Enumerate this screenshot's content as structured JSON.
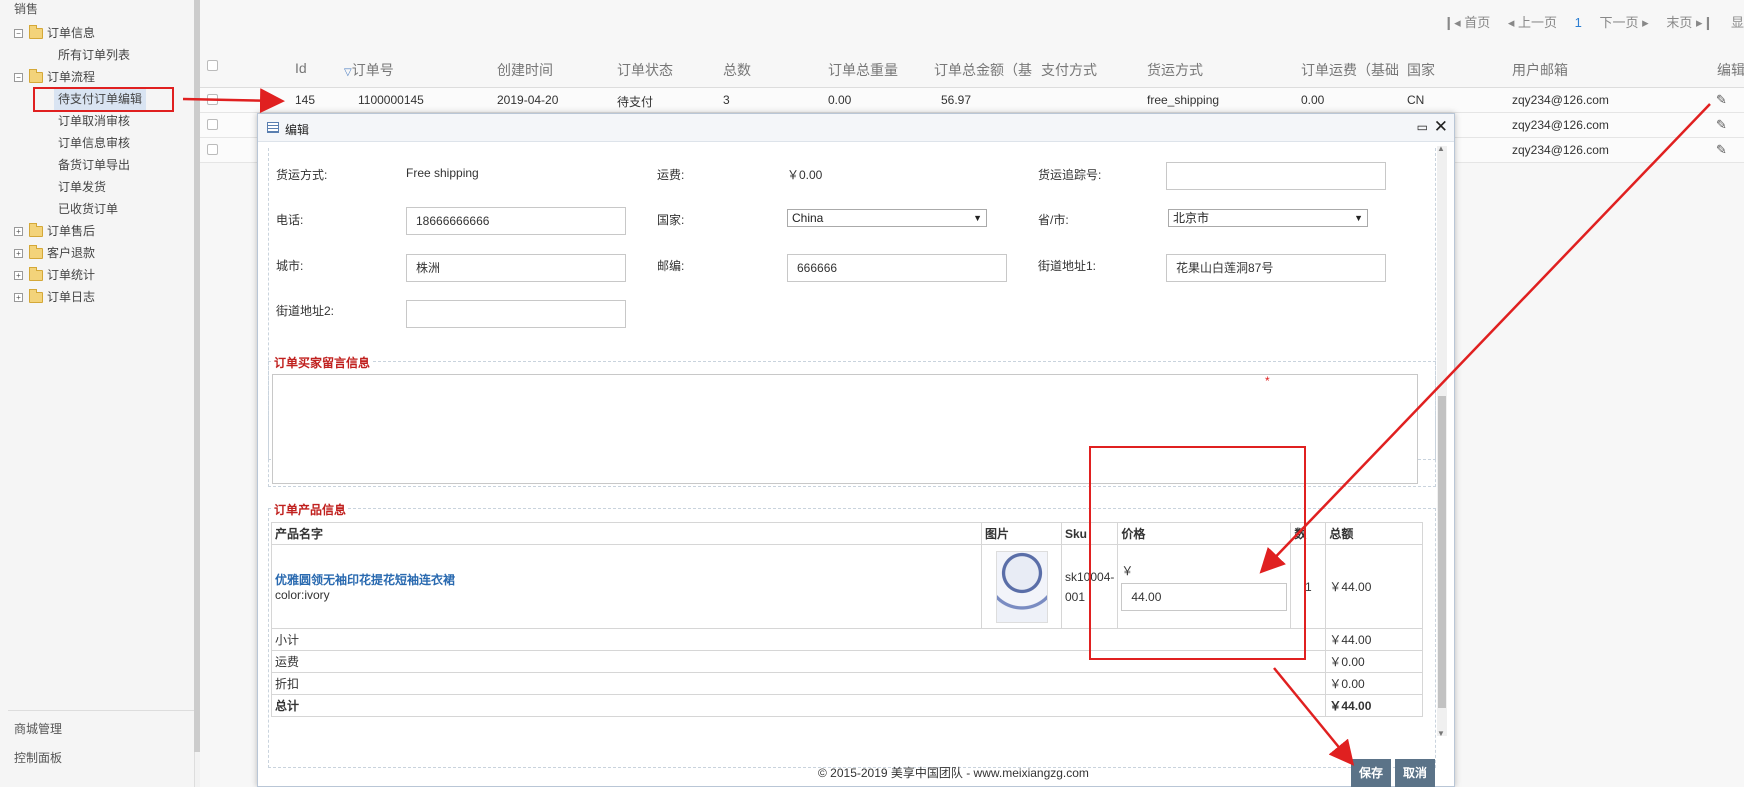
{
  "sidebar": {
    "section_title": "销售",
    "tree": [
      {
        "label": "订单信息",
        "toggle": "−"
      },
      {
        "label": "订单流程",
        "toggle": "−"
      },
      {
        "label": "订单售后",
        "toggle": "+"
      },
      {
        "label": "客户退款",
        "toggle": "+"
      },
      {
        "label": "订单统计",
        "toggle": "+"
      },
      {
        "label": "订单日志",
        "toggle": "+"
      }
    ],
    "leaves": [
      "所有订单列表",
      "待支付订单编辑",
      "订单取消审核",
      "订单信息审核",
      "备货订单导出",
      "订单发货",
      "已收货订单"
    ],
    "bottom": [
      "商城管理",
      "控制面板"
    ]
  },
  "pager": {
    "first": "首页",
    "prev": "上一页",
    "current": "1",
    "next": "下一页",
    "last": "末页",
    "extra": "显"
  },
  "grid": {
    "headers": [
      "Id",
      "订单号",
      "创建时间",
      "订单状态",
      "总数",
      "订单总重量",
      "订单总金额（基",
      "支付方式",
      "货运方式",
      "订单运费（基础",
      "国家",
      "用户邮箱",
      "编辑"
    ],
    "rows": [
      {
        "id": "145",
        "order_no": "1100000145",
        "created": "2019-04-20",
        "status": "待支付",
        "total": "3",
        "weight": "0.00",
        "amount": "56.97",
        "shipping": "free_shipping",
        "freight": "0.00",
        "country": "CN",
        "email": "zqy234@126.com"
      },
      {
        "email": "zqy234@126.com"
      },
      {
        "email": "zqy234@126.com"
      }
    ]
  },
  "modal": {
    "title": "编辑",
    "fields": {
      "shipping_label": "货运方式:",
      "shipping_value": "Free shipping",
      "freight_label": "运费:",
      "freight_value": "￥0.00",
      "tracking_label": "货运追踪号:",
      "tracking_value": "",
      "phone_label": "电话:",
      "phone_value": "18666666666",
      "country_label": "国家:",
      "country_value": "China",
      "province_label": "省/市:",
      "province_value": "北京市",
      "city_label": "城市:",
      "city_value": "株洲",
      "zip_label": "邮编:",
      "zip_value": "666666",
      "street1_label": "街道地址1:",
      "street1_value": "花果山白莲洞87号",
      "street2_label": "街道地址2:",
      "street2_value": ""
    },
    "message_legend": "订单买家留言信息",
    "product_legend": "订单产品信息",
    "product_table": {
      "headers": [
        "产品名字",
        "图片",
        "Sku",
        "价格",
        "数",
        "总额"
      ],
      "product_name": "优雅圆领无袖印花提花短袖连衣裙",
      "product_option": "color:ivory",
      "sku": "sk10004-001",
      "currency": "￥",
      "price": "44.00",
      "qty": "1",
      "row_total": "￥44.00",
      "subtotal_label": "小计",
      "subtotal": "￥44.00",
      "freight_label": "运费",
      "freight": "￥0.00",
      "discount_label": "折扣",
      "discount": "￥0.00",
      "total_label": "总计",
      "total": "￥44.00"
    },
    "footer": "© 2015-2019 美享中国团队 - www.meixiangzg.com",
    "save": "保存",
    "cancel": "取消"
  },
  "colors": {
    "annotation_red": "#e02020",
    "link_blue": "#2a6ab0",
    "button": "#5b7388"
  }
}
